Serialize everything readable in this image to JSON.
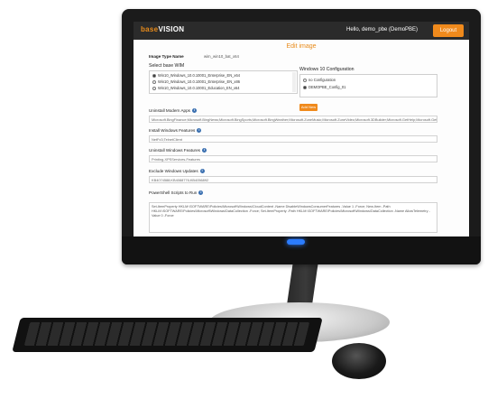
{
  "header": {
    "logo_base": "base",
    "logo_vision": "VISION",
    "greeting": "Hello, demo_pbe (DemoPBE)",
    "logout_label": "Logout"
  },
  "page_title": "Edit image",
  "image_type": {
    "label": "Image Type Name",
    "value": "wim_win10_bat_x64"
  },
  "base_wim": {
    "label": "Select base WIM",
    "options": [
      {
        "label": "Win10_Windows_10.0.10001_Enterprise_EN_x64",
        "selected": true
      },
      {
        "label": "Win10_Windows_10.0.10001_Enterprise_EN_x86",
        "selected": false
      },
      {
        "label": "Win10_Windows_10.0.10001_Education_EN_x64",
        "selected": false
      }
    ]
  },
  "win10_config": {
    "label": "Windows 10 Configuration",
    "options": [
      {
        "label": "no Configuration",
        "selected": false
      },
      {
        "label": "DEMOPBE_Config_01",
        "selected": true
      }
    ],
    "add_button": "Add New"
  },
  "uninstall_apps": {
    "label": "Uninstall Modern Apps",
    "value": "Microsoft.BingFinance;Microsoft.BingNews;Microsoft.BingSports;Microsoft.BingWeather;Microsoft.ZuneMusic;Microsoft.ZuneVideo;Microsoft.3DBuilder;Microsoft.GetHelp;Microsoft.Getstarted;Microsoft.Office.OneNote"
  },
  "install_features": {
    "label": "Install Windows Features",
    "value": "NetFx3;TelnetClient"
  },
  "uninstall_features": {
    "label": "Uninstall Windows Features",
    "value": "Printing-XPSServices-Features"
  },
  "exclude_updates": {
    "label": "Exclude Windows Updates",
    "value": "KB4074588;KB4088776;KB4056892"
  },
  "powershell": {
    "label": "PowerShell Scripts to Run",
    "value": "Set-ItemProperty HKLM:\\SOFTWARE\\Policies\\Microsoft\\Windows\\CloudContent -Name DisableWindowsConsumerFeatures -Value 1 -Force; New-Item -Path HKLM:\\SOFTWARE\\Policies\\Microsoft\\Windows\\DataCollection -Force; Set-ItemProperty -Path HKLM:\\SOFTWARE\\Policies\\Microsoft\\Windows\\DataCollection -Name AllowTelemetry -Value 0 -Force"
  },
  "colors": {
    "accent": "#f08a1c",
    "topbar": "#2b2b2b",
    "info_icon": "#3a6fb0"
  }
}
